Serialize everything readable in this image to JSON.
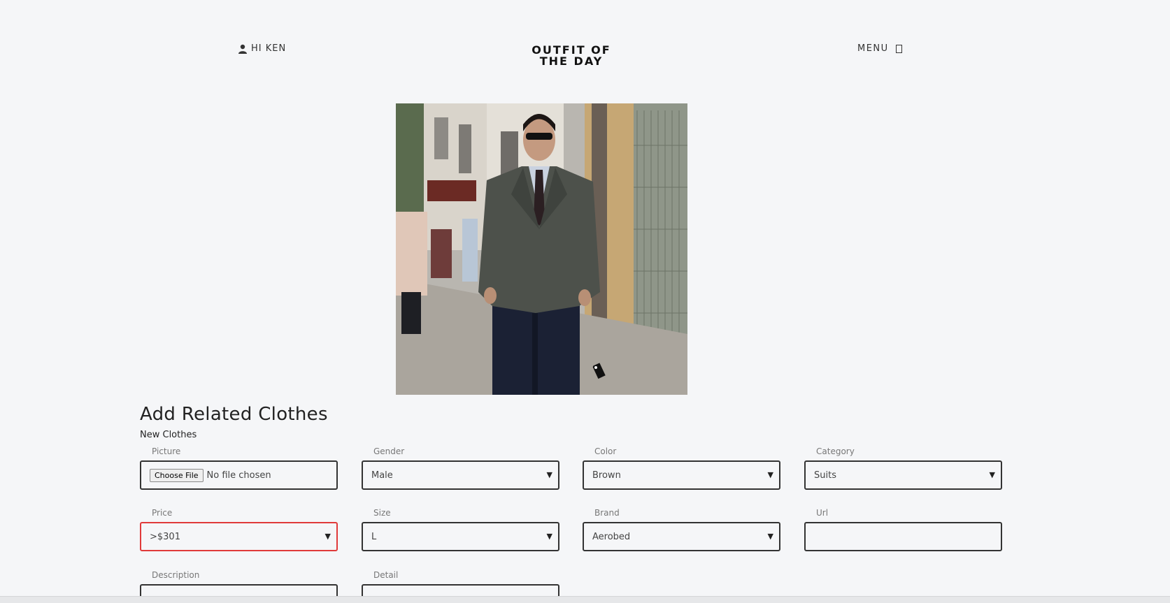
{
  "header": {
    "greeting": "HI KEN",
    "brand_line1": "OUTFIT OF",
    "brand_line2": "THE DAY",
    "menu_label": "MENU"
  },
  "photo": {
    "alt": "man in double-breasted suit on street",
    "tag_icon": "tag-icon"
  },
  "section": {
    "title": "Add Related Clothes",
    "subtitle": "New Clothes"
  },
  "form": {
    "picture": {
      "label": "Picture",
      "button": "Choose File",
      "status": "No file chosen"
    },
    "gender": {
      "label": "Gender",
      "value": "Male"
    },
    "color": {
      "label": "Color",
      "value": "Brown"
    },
    "category": {
      "label": "Category",
      "value": "Suits"
    },
    "price": {
      "label": "Price",
      "value": ">$301"
    },
    "size": {
      "label": "Size",
      "value": "L"
    },
    "brand": {
      "label": "Brand",
      "value": "Aerobed"
    },
    "url": {
      "label": "Url",
      "value": ""
    },
    "description": {
      "label": "Description",
      "value": ""
    },
    "detail": {
      "label": "Detail",
      "value": ""
    }
  },
  "colors": {
    "background": "#f5f6f8",
    "border": "#333333",
    "error": "#e03a3a"
  }
}
